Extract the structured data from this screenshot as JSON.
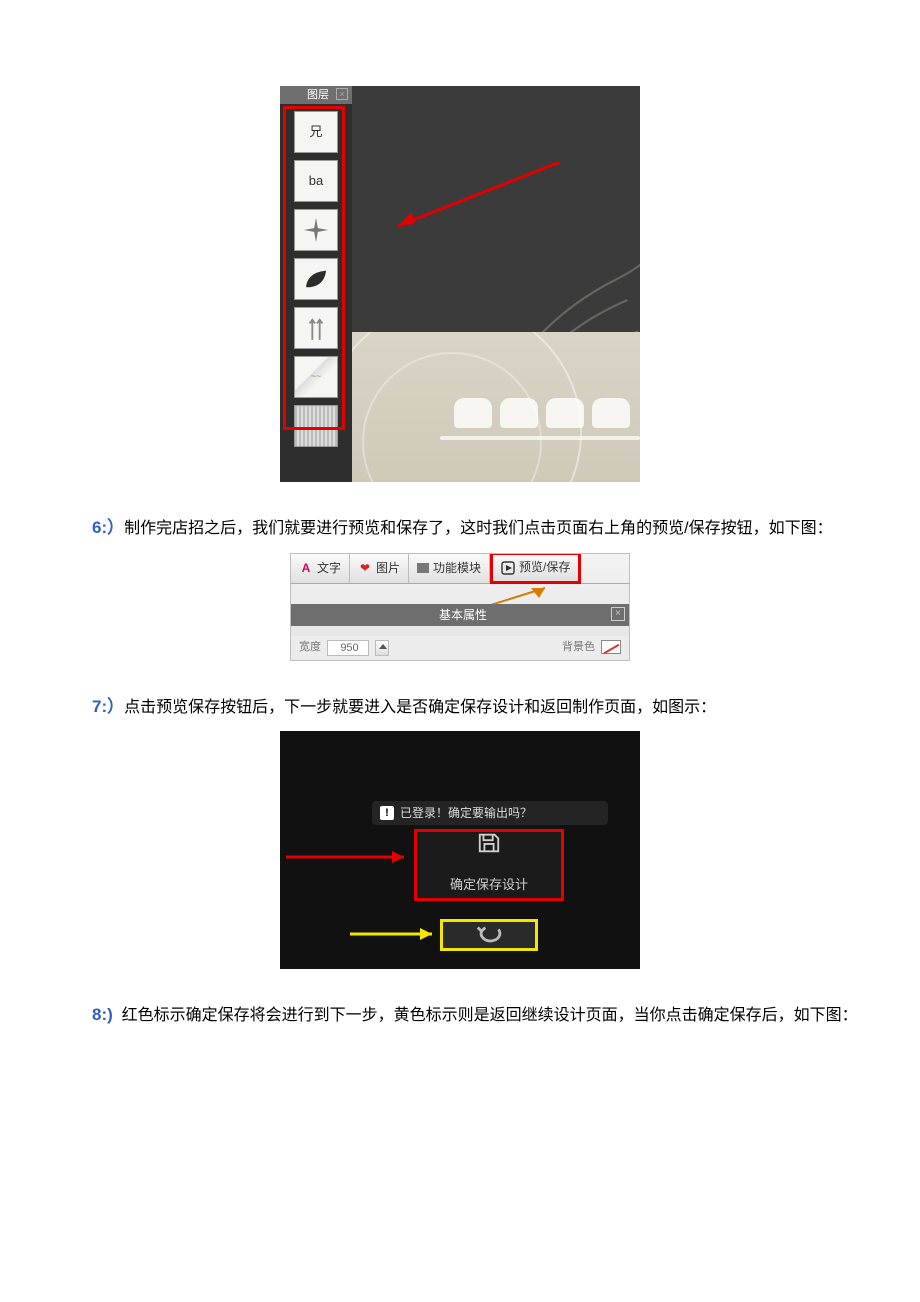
{
  "steps": {
    "s6": {
      "num": "6:）",
      "text": "制作完店招之后，我们就要进行预览和保存了，这时我们点击页面右上角的预览/保存按钮，如下图："
    },
    "s7": {
      "num": "7:）",
      "text": "点击预览保存按钮后，下一步就要进入是否确定保存设计和返回制作页面，如图示："
    },
    "s8": {
      "num": "8:)",
      "text": "红色标示确定保存将会进行到下一步，黄色标示则是返回继续设计页面，当你点击确定保存后，如下图："
    }
  },
  "fig1": {
    "panel_title": "图层",
    "layers": [
      "兄",
      "ba",
      "*",
      "leaf",
      "arrows",
      "pattern",
      "texture"
    ]
  },
  "fig2": {
    "tabs": {
      "text": "文字",
      "image": "图片",
      "module": "功能模块",
      "preview": "预览/保存"
    },
    "prop_label": "基本属性",
    "width_label": "宽度",
    "width_value": "950",
    "bg_label": "背景色"
  },
  "fig3": {
    "banner": "已登录！确定要输出吗？",
    "save_label": "确定保存设计"
  }
}
